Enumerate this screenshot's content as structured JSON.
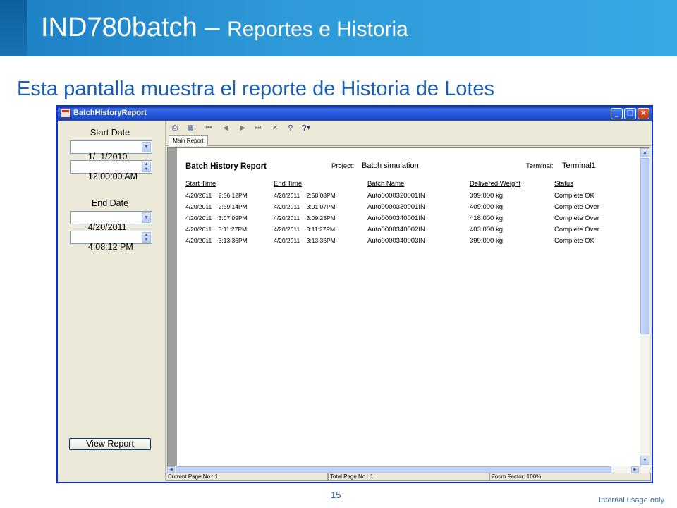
{
  "slide": {
    "title_main": "IND780batch",
    "title_sep": " – ",
    "title_sub": "Reportes e Historia",
    "subtitle": "Esta pantalla muestra el reporte de Historia de Lotes",
    "page_number": "15",
    "footer_note": "Internal  usage only"
  },
  "window": {
    "title": "BatchHistoryReport",
    "buttons": {
      "minimize": "_",
      "maximize": "□",
      "close": "×"
    }
  },
  "left_panel": {
    "start_date_label": "Start Date",
    "start_date_value": "1/  1/2010",
    "start_time_value": "12:00:00 AM",
    "end_date_label": "End Date",
    "end_date_value": "4/20/2011",
    "end_time_value": "4:08:12 PM",
    "view_report_label": "View Report"
  },
  "viewer": {
    "tab_label": "Main Report",
    "toolbar_icons": [
      "print-icon",
      "export-icon",
      "first-page-icon",
      "prev-page-icon",
      "next-page-icon",
      "last-page-icon",
      "stop-icon",
      "search-icon",
      "zoom-icon"
    ],
    "status": {
      "current_page": "Current Page No.: 1",
      "total_page": "Total Page No.: 1",
      "zoom_factor": "Zoom Factor: 100%"
    }
  },
  "report": {
    "title": "Batch History Report",
    "project_label": "Project:",
    "project_value": "Batch simulation",
    "terminal_label": "Terminal:",
    "terminal_value": "Terminal1",
    "columns": [
      "Start Time",
      "End Time",
      "Batch Name",
      "Delivered Weight",
      "Status"
    ],
    "rows": [
      [
        "4/20/2011    2:56:12PM",
        "4/20/2011    2:58:08PM",
        "Auto0000320001IN",
        "399.000 kg",
        "Complete OK"
      ],
      [
        "4/20/2011    2:59:14PM",
        "4/20/2011    3:01:07PM",
        "Auto0000330001IN",
        "409.000 kg",
        "Complete Over"
      ],
      [
        "4/20/2011    3:07:09PM",
        "4/20/2011    3:09:23PM",
        "Auto0000340001IN",
        "418.000 kg",
        "Complete Over"
      ],
      [
        "4/20/2011    3:11:27PM",
        "4/20/2011    3:11:27PM",
        "Auto0000340002IN",
        "403.000 kg",
        "Complete Over"
      ],
      [
        "4/20/2011    3:13:36PM",
        "4/20/2011    3:13:36PM",
        "Auto0000340003IN",
        "399.000 kg",
        "Complete OK"
      ]
    ]
  }
}
